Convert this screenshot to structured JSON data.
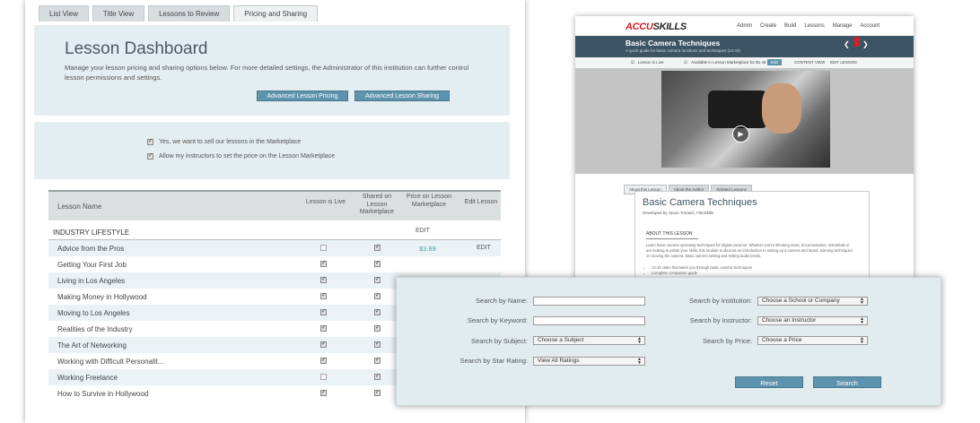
{
  "tabs": [
    "List View",
    "Title View",
    "Lessons to Review",
    "Pricing and Sharing"
  ],
  "dashboard": {
    "title": "Lesson Dashboard",
    "description": "Manage your lesson pricing and sharing options below. For more detailed settings, the Administrator of this institution can further control lesson permissions and settings.",
    "pricing_button": "Advanced Lesson Pricing",
    "sharing_button": "Advanced Lesson Sharing"
  },
  "options": {
    "sell": "Yes, we want to sell our lessons in the Marketplace",
    "instructors": "Allow my instructors to set the price on the Lesson Marketplace"
  },
  "table": {
    "headers": {
      "name": "Lesson Name",
      "live": "Lesson is Live",
      "shared": "Shared on Lesson Marketplace",
      "price": "Price on Lesson Marketplace",
      "edit": "Edit Lesson"
    },
    "group_name": "INDUSTRY LIFESTYLE",
    "group_edit": "EDIT",
    "rows": [
      {
        "name": "Advice from the Pros",
        "live": false,
        "shared": true,
        "price": "$3.99",
        "edit": "EDIT"
      },
      {
        "name": "Getting Your First Job",
        "live": true,
        "shared": true,
        "price": "",
        "edit": ""
      },
      {
        "name": "Living in Los Angeles",
        "live": true,
        "shared": true,
        "price": "",
        "edit": ""
      },
      {
        "name": "Making Money in Hollywood",
        "live": true,
        "shared": true,
        "price": "",
        "edit": ""
      },
      {
        "name": "Moving to Los Angeles",
        "live": true,
        "shared": true,
        "price": "",
        "edit": ""
      },
      {
        "name": "Realities of the Industry",
        "live": true,
        "shared": true,
        "price": "",
        "edit": ""
      },
      {
        "name": "The Art of Networking",
        "live": true,
        "shared": true,
        "price": "",
        "edit": ""
      },
      {
        "name": "Working with Difficult Personalit...",
        "live": true,
        "shared": true,
        "price": "",
        "edit": ""
      },
      {
        "name": "Working Freelance",
        "live": false,
        "shared": true,
        "price": "",
        "edit": ""
      },
      {
        "name": "How to Survive in Hollywood",
        "live": true,
        "shared": true,
        "price": "",
        "edit": ""
      }
    ]
  },
  "lesson_page": {
    "logo_a": "ACCU",
    "logo_b": "SKILLS",
    "nav": [
      "Admin",
      "Create",
      "Build",
      "Lessons",
      "Manage",
      "Account"
    ],
    "title": "Basic Camera Techniques",
    "subtitle": "A quick guide for basic camera functions and techniques (14:43)",
    "status_live": "Lesson is Live",
    "status_market": "Available in Lesson Marketplace for $1.49",
    "status_edit_btn": "Edit",
    "content_view": "CONTENT VIEW",
    "edit_lesson": "EDIT LESSON",
    "tabs": [
      "About this Lesson",
      "About the Author",
      "Related Lessons"
    ],
    "heading": "Basic Camera Techniques",
    "byline": "Developed by Jason Tomaric, FilmSkills",
    "about_title": "ABOUT THIS LESSON",
    "description": "Learn basic camera operating techniques for digital cameras. Whether you're shooting news, documentaries, industrials or are looking to polish your skills, this module is ideal as an introduction to setting up a camera and tripod, learning techniques on moving the camera, basic camera setting and setting audio levels.",
    "bullets": [
      "14:43 video that takes you through basic camera techniques",
      "Complete companion guide"
    ]
  },
  "search": {
    "name_label": "Search by Name:",
    "keyword_label": "Search by Keyword:",
    "subject_label": "Search by Subject:",
    "rating_label": "Search by Star Rating:",
    "institution_label": "Search by Institution:",
    "instructor_label": "Search by Instructor:",
    "price_label": "Search by Price:",
    "subject_value": "Choose a Subject",
    "rating_value": "View All Ratings",
    "institution_value": "Choose a School or Company",
    "instructor_value": "Choose an Instructor",
    "price_value": "Choose a Price",
    "reset": "Reset",
    "search": "Search"
  }
}
